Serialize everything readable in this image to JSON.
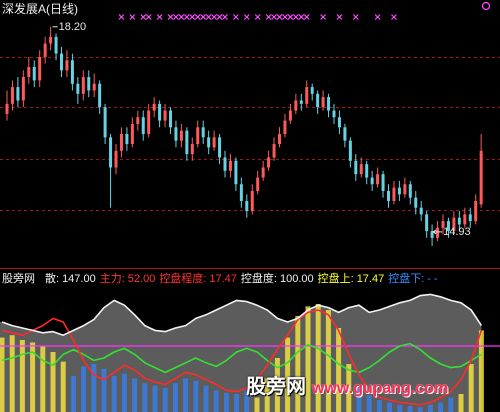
{
  "panel_label": "股旁网",
  "watermark": {
    "cn": "股旁网",
    "url": "www.gupang.com"
  },
  "chart_data": [
    {
      "type": "candlestick",
      "title": "深发展A(日线)",
      "ylim": [
        14.6,
        18.6
      ],
      "grid": true,
      "max_label": "18.20",
      "max_index": 8,
      "min_label": "14.93",
      "min_index": 78,
      "colors": {
        "up": "#ff5a5a",
        "down": "#66d3e4",
        "signal": "#ff4dff",
        "grid": "#a31414",
        "label": "#e6e6e6"
      },
      "open": [
        16.9,
        17.05,
        17.3,
        17.1,
        17.45,
        17.6,
        17.4,
        17.75,
        17.95,
        18.05,
        17.8,
        17.55,
        17.7,
        17.35,
        17.2,
        17.45,
        17.25,
        17.35,
        17.0,
        16.55,
        16.1,
        16.35,
        16.6,
        16.45,
        16.75,
        16.85,
        16.6,
        16.95,
        17.05,
        16.8,
        16.95,
        16.7,
        16.5,
        16.65,
        16.3,
        16.45,
        16.7,
        16.55,
        16.4,
        16.55,
        16.25,
        16.05,
        16.2,
        15.85,
        15.6,
        15.45,
        15.75,
        15.95,
        16.1,
        16.25,
        16.45,
        16.6,
        16.8,
        16.95,
        17.1,
        17.05,
        17.3,
        17.2,
        17.0,
        17.15,
        16.95,
        16.85,
        16.7,
        16.5,
        16.2,
        16.0,
        16.15,
        15.95,
        15.85,
        16.0,
        15.75,
        15.6,
        15.8,
        15.7,
        15.85,
        15.65,
        15.5,
        15.4,
        15.15,
        15.05,
        15.2,
        15.3,
        15.15,
        15.35,
        15.25,
        15.4,
        15.3,
        15.55
      ],
      "high": [
        17.25,
        17.4,
        17.45,
        17.55,
        17.75,
        17.7,
        17.85,
        18.05,
        18.2,
        18.1,
        17.9,
        17.85,
        17.8,
        17.45,
        17.55,
        17.55,
        17.5,
        17.4,
        17.05,
        16.6,
        16.45,
        16.7,
        16.7,
        16.85,
        16.95,
        16.95,
        17.05,
        17.15,
        17.1,
        17.05,
        17.0,
        16.8,
        16.75,
        16.7,
        16.55,
        16.8,
        16.8,
        16.65,
        16.65,
        16.6,
        16.35,
        16.3,
        16.25,
        15.95,
        15.7,
        15.85,
        16.05,
        16.2,
        16.35,
        16.55,
        16.7,
        16.9,
        17.05,
        17.2,
        17.2,
        17.4,
        17.35,
        17.25,
        17.25,
        17.2,
        17.05,
        16.95,
        16.75,
        16.55,
        16.3,
        16.25,
        16.2,
        16.05,
        16.1,
        16.05,
        15.85,
        15.9,
        15.9,
        15.95,
        15.9,
        15.75,
        15.6,
        15.45,
        15.25,
        15.3,
        15.4,
        15.35,
        15.45,
        15.45,
        15.5,
        15.5,
        15.7,
        16.6
      ],
      "low": [
        16.8,
        16.95,
        17.0,
        17.0,
        17.35,
        17.3,
        17.3,
        17.65,
        17.85,
        17.7,
        17.45,
        17.45,
        17.25,
        17.05,
        17.1,
        17.15,
        17.15,
        16.9,
        16.45,
        15.5,
        16.0,
        16.25,
        16.35,
        16.4,
        16.65,
        16.5,
        16.55,
        16.85,
        16.7,
        16.7,
        16.6,
        16.4,
        16.4,
        16.2,
        16.2,
        16.4,
        16.45,
        16.3,
        16.35,
        16.15,
        15.95,
        15.95,
        15.75,
        15.5,
        15.35,
        15.4,
        15.7,
        15.9,
        16.05,
        16.2,
        16.4,
        16.55,
        16.75,
        16.9,
        16.95,
        17.0,
        17.1,
        16.9,
        16.95,
        16.85,
        16.75,
        16.6,
        16.4,
        16.1,
        15.9,
        15.95,
        15.85,
        15.75,
        15.8,
        15.65,
        15.5,
        15.55,
        15.6,
        15.65,
        15.55,
        15.4,
        15.3,
        15.05,
        14.93,
        15.0,
        15.1,
        15.05,
        15.1,
        15.15,
        15.2,
        15.2,
        15.25,
        15.5
      ],
      "close": [
        17.05,
        17.3,
        17.1,
        17.45,
        17.6,
        17.4,
        17.75,
        17.95,
        18.05,
        17.8,
        17.55,
        17.7,
        17.35,
        17.2,
        17.45,
        17.25,
        17.35,
        17.0,
        16.55,
        16.1,
        16.35,
        16.6,
        16.45,
        16.75,
        16.85,
        16.6,
        16.95,
        17.05,
        16.8,
        16.95,
        16.7,
        16.5,
        16.65,
        16.3,
        16.45,
        16.7,
        16.55,
        16.4,
        16.55,
        16.25,
        16.05,
        16.2,
        15.85,
        15.6,
        15.45,
        15.75,
        15.95,
        16.1,
        16.25,
        16.45,
        16.6,
        16.8,
        16.95,
        17.1,
        17.05,
        17.3,
        17.2,
        17.0,
        17.15,
        16.95,
        16.85,
        16.7,
        16.5,
        16.2,
        16.0,
        16.15,
        15.95,
        15.85,
        16.0,
        15.75,
        15.6,
        15.8,
        15.7,
        15.85,
        15.65,
        15.5,
        15.4,
        15.15,
        15.05,
        15.2,
        15.3,
        15.15,
        15.35,
        15.25,
        15.4,
        15.3,
        15.6,
        16.35
      ],
      "signals": [
        21,
        23,
        25,
        26,
        28,
        30,
        31,
        32,
        33,
        34,
        35,
        36,
        37,
        38,
        39,
        40,
        42,
        44,
        46,
        48,
        49,
        50,
        51,
        52,
        53,
        54,
        55,
        58,
        61,
        64,
        68,
        71
      ]
    },
    {
      "type": "line",
      "ylim": [
        0,
        100
      ],
      "ref_line": 55,
      "ref_color": "#ff33ff",
      "series": [
        {
          "name": "散",
          "color": "#f2f2f2",
          "fill": "#5c5c5c",
          "values": [
            75,
            72,
            70,
            68,
            66,
            67,
            64,
            68,
            72,
            77,
            87,
            93,
            89,
            81,
            72,
            68,
            67,
            70,
            72,
            78,
            81,
            85,
            89,
            93,
            92,
            89,
            85,
            78,
            75,
            78,
            85,
            89,
            87,
            83,
            87,
            89,
            83,
            85,
            88,
            91,
            93,
            97,
            98,
            96,
            93,
            91,
            85,
            72
          ]
        },
        {
          "name": "主力",
          "color": "#ff2b2b",
          "values": [
            68,
            66,
            64,
            68,
            72,
            78,
            75,
            60,
            43,
            31,
            27,
            33,
            39,
            35,
            28,
            25,
            23,
            28,
            33,
            31,
            27,
            23,
            18,
            17,
            20,
            27,
            39,
            52,
            64,
            77,
            83,
            85,
            81,
            68,
            48,
            31,
            18,
            12,
            10,
            8,
            7,
            6,
            8,
            12,
            17,
            27,
            43,
            68
          ]
        },
        {
          "color": "#33e033",
          "values": [
            43,
            45,
            48,
            50,
            43,
            39,
            48,
            52,
            48,
            43,
            45,
            50,
            53,
            48,
            41,
            37,
            33,
            37,
            41,
            45,
            41,
            38,
            43,
            50,
            53,
            50,
            43,
            37,
            41,
            50,
            56,
            53,
            47,
            40,
            35,
            33,
            37,
            43,
            50,
            55,
            57,
            52,
            45,
            40,
            37,
            38,
            43,
            48
          ]
        }
      ],
      "bars": {
        "up_color": "#f0e040",
        "down_color": "#3a7be0",
        "up": [
          62,
          64,
          60,
          58,
          55,
          50,
          42,
          0,
          0,
          0,
          0,
          0,
          0,
          0,
          0,
          0,
          0,
          0,
          0,
          0,
          0,
          0,
          0,
          0,
          0,
          12,
          28,
          45,
          62,
          80,
          88,
          90,
          85,
          70,
          40,
          0,
          0,
          0,
          0,
          0,
          0,
          0,
          0,
          0,
          0,
          15,
          40,
          68
        ],
        "down": [
          0,
          0,
          0,
          0,
          0,
          0,
          0,
          30,
          38,
          40,
          36,
          30,
          32,
          28,
          24,
          22,
          20,
          24,
          28,
          26,
          22,
          18,
          16,
          15,
          18,
          0,
          0,
          0,
          0,
          0,
          0,
          0,
          0,
          0,
          0,
          20,
          14,
          10,
          8,
          6,
          5,
          4,
          6,
          8,
          12,
          0,
          0,
          0
        ]
      },
      "legend": [
        {
          "label": "散:",
          "value": "147.00",
          "color": "#f0f0f0"
        },
        {
          "label": "主力:",
          "value": "52.00",
          "color": "#ff3b3b"
        },
        {
          "label": "控盘程度:",
          "value": "17.47",
          "color": "#ff3030"
        },
        {
          "label": "控盘度:",
          "value": "100.00",
          "color": "#f0f0f0"
        },
        {
          "label": "控盘上:",
          "value": "17.47",
          "color": "#ffff33"
        },
        {
          "label": "控盘下:",
          "value": "- -",
          "color": "#2f8fff"
        }
      ]
    }
  ]
}
